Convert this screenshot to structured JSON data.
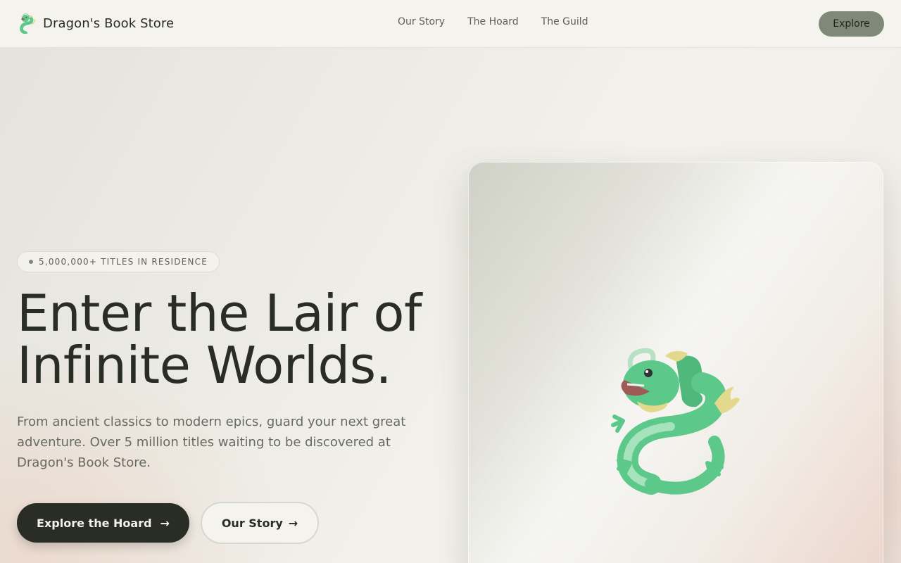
{
  "header": {
    "brand_name": "Dragon's Book Store",
    "brand_icon": "dragon-icon",
    "nav": [
      {
        "label": "Our Story"
      },
      {
        "label": "The Hoard"
      },
      {
        "label": "The Guild"
      }
    ],
    "cta_label": "Explore"
  },
  "hero": {
    "badge": "5,000,000+ TITLES IN RESIDENCE",
    "headline_line1": "Enter the Lair of",
    "headline_line2": "Infinite Worlds.",
    "subtitle": "From ancient classics to modern epics, guard your next great adventure. Over 5 million titles waiting to be discovered at Dragon's Book Store.",
    "primary_button": {
      "label": "Explore the Hoard",
      "icon": "→"
    },
    "secondary_button": {
      "label": "Our Story",
      "icon": "→"
    },
    "art_icon": "dragon-icon"
  },
  "colors": {
    "accent": "#7e8a77",
    "dark": "#2a2c26",
    "dragon_green": "#5cc98a"
  }
}
